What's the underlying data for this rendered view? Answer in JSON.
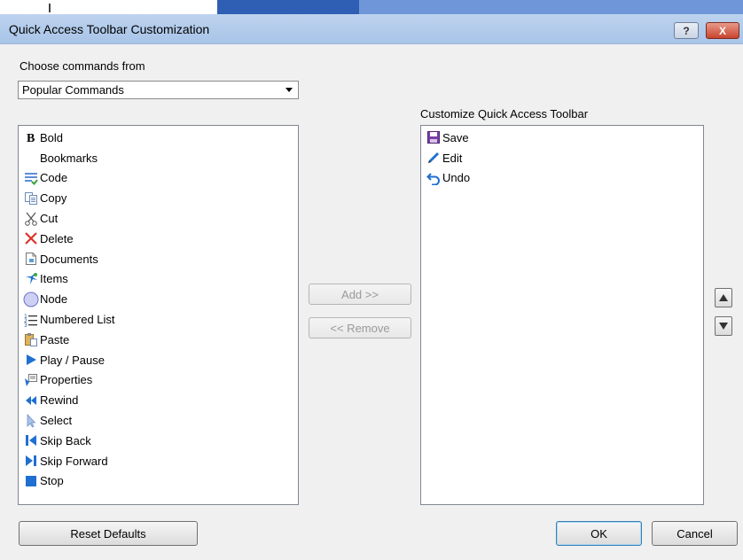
{
  "dialog": {
    "title": "Quick Access Toolbar Customization",
    "help_label": "?",
    "close_label": "X"
  },
  "left_panel": {
    "label": "Choose commands from",
    "dropdown_value": "Popular Commands",
    "items": [
      {
        "label": "Bold",
        "icon": "bold-icon"
      },
      {
        "label": "Bookmarks",
        "icon": ""
      },
      {
        "label": "Code",
        "icon": "code-icon"
      },
      {
        "label": "Copy",
        "icon": "copy-icon"
      },
      {
        "label": "Cut",
        "icon": "scissors-icon"
      },
      {
        "label": "Delete",
        "icon": "delete-icon"
      },
      {
        "label": "Documents",
        "icon": "document-icon"
      },
      {
        "label": "Items",
        "icon": "items-icon"
      },
      {
        "label": "Node",
        "icon": "node-icon"
      },
      {
        "label": "Numbered List",
        "icon": "numbered-list-icon"
      },
      {
        "label": "Paste",
        "icon": "paste-icon"
      },
      {
        "label": "Play / Pause",
        "icon": "play-icon"
      },
      {
        "label": "Properties",
        "icon": "properties-icon"
      },
      {
        "label": "Rewind",
        "icon": "rewind-icon"
      },
      {
        "label": "Select",
        "icon": "cursor-icon"
      },
      {
        "label": "Skip Back",
        "icon": "skip-back-icon"
      },
      {
        "label": "Skip Forward",
        "icon": "skip-forward-icon"
      },
      {
        "label": "Stop",
        "icon": "stop-icon"
      }
    ]
  },
  "right_panel": {
    "label": "Customize Quick Access Toolbar",
    "items": [
      {
        "label": "Save",
        "icon": "save-icon"
      },
      {
        "label": "Edit",
        "icon": "pencil-icon"
      },
      {
        "label": "Undo",
        "icon": "undo-icon"
      }
    ]
  },
  "buttons": {
    "add": "Add >>",
    "remove": "<< Remove",
    "reset": "Reset Defaults",
    "ok": "OK",
    "cancel": "Cancel"
  },
  "colors": {
    "title_bar": "#b5cdeb",
    "close_button": "#c8442f",
    "blue_icon": "#1f6fd1",
    "red_icon": "#d9342b"
  }
}
